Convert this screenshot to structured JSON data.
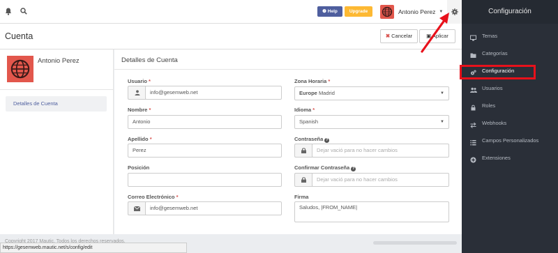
{
  "topbar": {
    "help_label": "Help",
    "upgrade_label": "Upgrade",
    "user_name": "Antonio Perez",
    "icons": [
      "bell-icon",
      "search-icon",
      "caret-down-icon",
      "gear-icon"
    ]
  },
  "header": {
    "title": "Cuenta",
    "cancel_label": "Cancelar",
    "apply_label": "Aplicar"
  },
  "profile": {
    "name": "Antonio Perez",
    "nav_item": "Detalles de Cuenta"
  },
  "form": {
    "title": "Detalles de Cuenta",
    "usuario": {
      "label": "Usuario",
      "value": "info@gesemweb.net"
    },
    "nombre": {
      "label": "Nombre",
      "value": "Antonio"
    },
    "apellido": {
      "label": "Apellido",
      "value": "Perez"
    },
    "posicion": {
      "label": "Posición",
      "value": ""
    },
    "correo": {
      "label": "Correo Electrónico",
      "value": "info@gesemweb.net"
    },
    "zona": {
      "label": "Zona Horaria",
      "value_group": "Europe",
      "value": "Madrid"
    },
    "idioma": {
      "label": "Idioma",
      "value": "Spanish"
    },
    "contrasena": {
      "label": "Contraseña",
      "placeholder": "Dejar vació para no hacer cambios"
    },
    "confirmar": {
      "label": "Confirmar Contraseña",
      "placeholder": "Dejar vació para no hacer cambios"
    },
    "firma": {
      "label": "Firma",
      "value": "Saludos, |FROM_NAME|"
    }
  },
  "footer": {
    "copyright": "Copyright 2017 Mautic. Todos los derechos reservados.",
    "status_url": "https://gesemweb.mautic.net/s/config/edit"
  },
  "sidebar": {
    "title": "Configuración",
    "items": [
      {
        "label": "Temas",
        "icon": "desktop-icon"
      },
      {
        "label": "Categorías",
        "icon": "folder-icon"
      },
      {
        "label": "Configuración",
        "icon": "cogs-icon"
      },
      {
        "label": "Usuarios",
        "icon": "users-icon"
      },
      {
        "label": "Roles",
        "icon": "lock-icon"
      },
      {
        "label": "Webhooks",
        "icon": "exchange-icon"
      },
      {
        "label": "Campos Personalizados",
        "icon": "list-icon"
      },
      {
        "label": "Extensiones",
        "icon": "plus-circle-icon"
      }
    ]
  },
  "colors": {
    "help": "#4e5e9e",
    "upgrade": "#fdb933",
    "required": "#d9534f",
    "sidebar_bg": "#2a2f38",
    "highlight": "#e8111b"
  }
}
